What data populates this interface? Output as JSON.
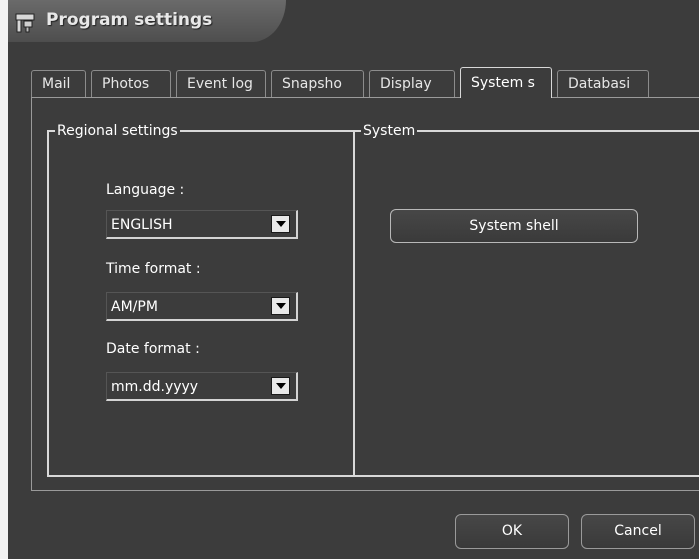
{
  "window": {
    "title": "Program settings"
  },
  "tabs": [
    {
      "label": "Mail"
    },
    {
      "label": "Photos"
    },
    {
      "label": "Event log"
    },
    {
      "label": "Snapsho"
    },
    {
      "label": "Display"
    },
    {
      "label": "System s",
      "active": true
    },
    {
      "label": "Databasi"
    }
  ],
  "regional": {
    "title": "Regional settings",
    "language": {
      "label": "Language :",
      "value": "ENGLISH"
    },
    "time_format": {
      "label": "Time format :",
      "value": "AM/PM"
    },
    "date_format": {
      "label": "Date format :",
      "value": "mm.dd.yyyy"
    }
  },
  "system": {
    "title": "System",
    "shell_button": "System shell"
  },
  "footer": {
    "ok": "OK",
    "cancel": "Cancel"
  },
  "colors": {
    "background": "#3c3c3c",
    "border": "#d9d9d9",
    "text": "#ffffff"
  }
}
